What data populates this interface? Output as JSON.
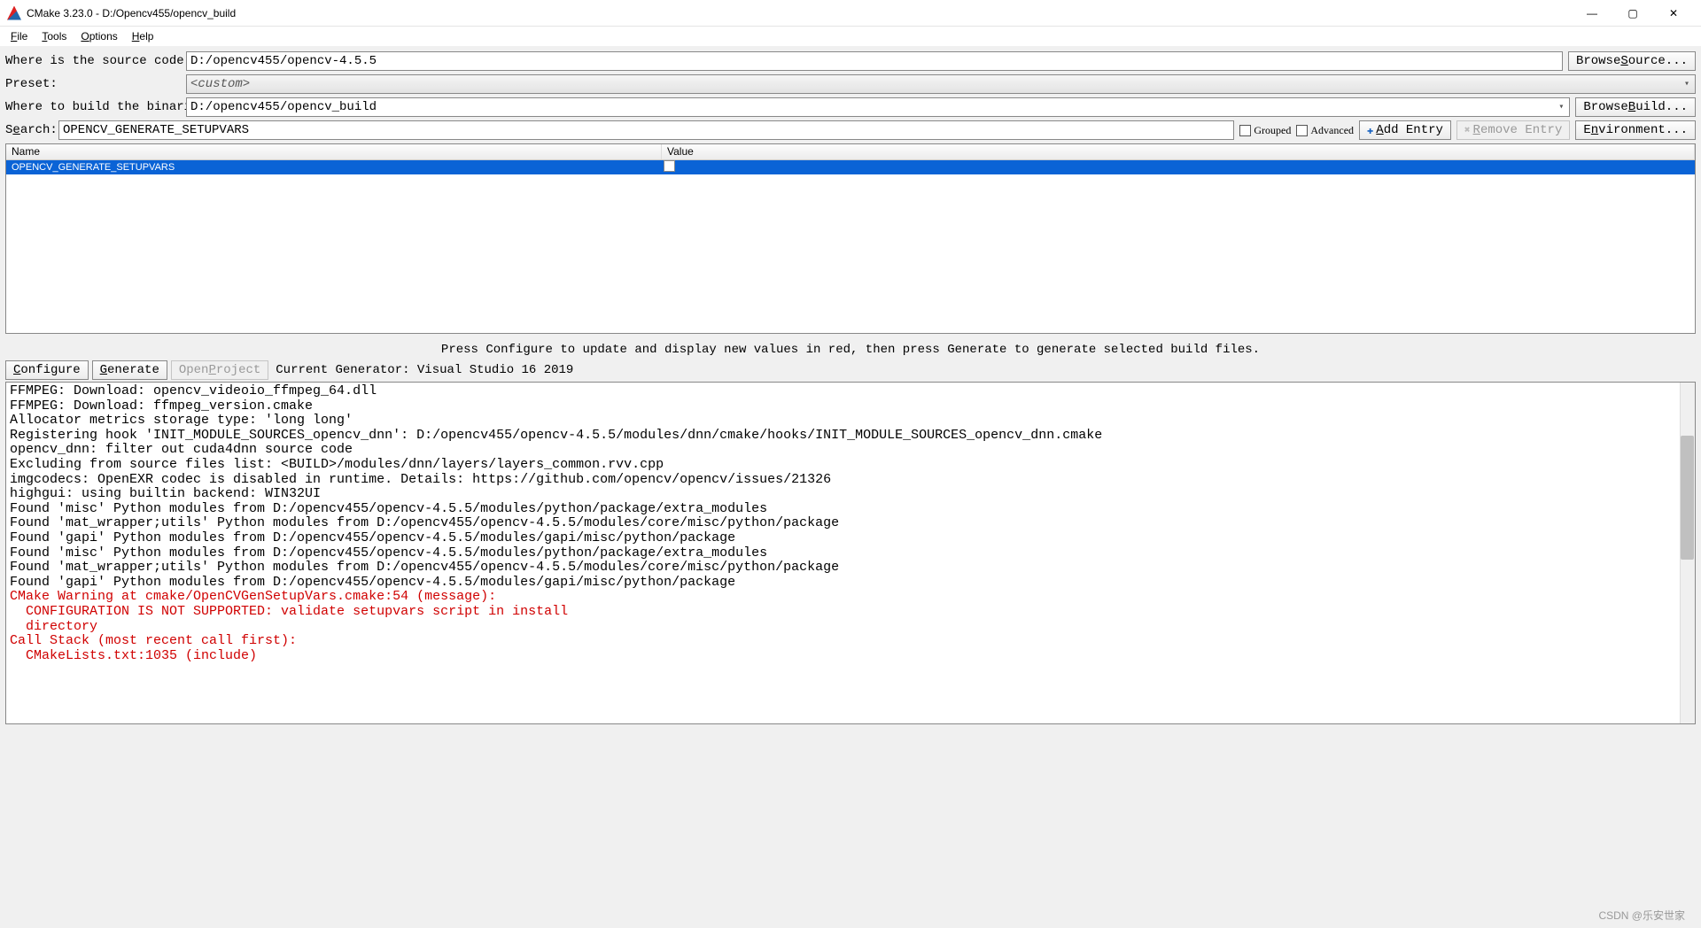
{
  "window": {
    "title": "CMake 3.23.0 - D:/Opencv455/opencv_build"
  },
  "menu": {
    "file": "File",
    "tools": "Tools",
    "options": "Options",
    "help": "Help"
  },
  "fields": {
    "source_label": "Where is the source code:",
    "source_value": "D:/opencv455/opencv-4.5.5",
    "browse_source": "Browse Source...",
    "preset_label": "Preset:",
    "preset_value": "<custom>",
    "build_label": "Where to build the binaries:",
    "build_value": "D:/opencv455/opencv_build",
    "browse_build": "Browse Build...",
    "search_label": "Search:",
    "search_value": "OPENCV_GENERATE_SETUPVARS",
    "grouped": "Grouped",
    "advanced": "Advanced",
    "add_entry": "Add Entry",
    "remove_entry": "Remove Entry",
    "environment": "Environment..."
  },
  "table": {
    "head_name": "Name",
    "head_value": "Value",
    "row_name": "OPENCV_GENERATE_SETUPVARS"
  },
  "hint": "Press Configure to update and display new values in red, then press Generate to generate selected build files.",
  "actions": {
    "configure": "Configure",
    "generate": "Generate",
    "open_project": "Open Project",
    "current_generator": "Current Generator: Visual Studio 16 2019"
  },
  "log_lines": [
    {
      "t": "FFMPEG: Download: opencv_videoio_ffmpeg_64.dll",
      "c": "n"
    },
    {
      "t": "FFMPEG: Download: ffmpeg_version.cmake",
      "c": "n"
    },
    {
      "t": "Allocator metrics storage type: 'long long'",
      "c": "n"
    },
    {
      "t": "Registering hook 'INIT_MODULE_SOURCES_opencv_dnn': D:/opencv455/opencv-4.5.5/modules/dnn/cmake/hooks/INIT_MODULE_SOURCES_opencv_dnn.cmake",
      "c": "n"
    },
    {
      "t": "opencv_dnn: filter out cuda4dnn source code",
      "c": "n"
    },
    {
      "t": "Excluding from source files list: <BUILD>/modules/dnn/layers/layers_common.rvv.cpp",
      "c": "n"
    },
    {
      "t": "imgcodecs: OpenEXR codec is disabled in runtime. Details: https://github.com/opencv/opencv/issues/21326",
      "c": "n"
    },
    {
      "t": "highgui: using builtin backend: WIN32UI",
      "c": "n"
    },
    {
      "t": "Found 'misc' Python modules from D:/opencv455/opencv-4.5.5/modules/python/package/extra_modules",
      "c": "n"
    },
    {
      "t": "Found 'mat_wrapper;utils' Python modules from D:/opencv455/opencv-4.5.5/modules/core/misc/python/package",
      "c": "n"
    },
    {
      "t": "Found 'gapi' Python modules from D:/opencv455/opencv-4.5.5/modules/gapi/misc/python/package",
      "c": "n"
    },
    {
      "t": "Found 'misc' Python modules from D:/opencv455/opencv-4.5.5/modules/python/package/extra_modules",
      "c": "n"
    },
    {
      "t": "Found 'mat_wrapper;utils' Python modules from D:/opencv455/opencv-4.5.5/modules/core/misc/python/package",
      "c": "n"
    },
    {
      "t": "Found 'gapi' Python modules from D:/opencv455/opencv-4.5.5/modules/gapi/misc/python/package",
      "c": "n"
    },
    {
      "t": "CMake Warning at cmake/OpenCVGenSetupVars.cmake:54 (message):",
      "c": "r"
    },
    {
      "t": "  CONFIGURATION IS NOT SUPPORTED: validate setupvars script in install",
      "c": "r"
    },
    {
      "t": "  directory",
      "c": "r"
    },
    {
      "t": "Call Stack (most recent call first):",
      "c": "r"
    },
    {
      "t": "  CMakeLists.txt:1035 (include)",
      "c": "r"
    }
  ],
  "watermark": "CSDN @乐安世家"
}
